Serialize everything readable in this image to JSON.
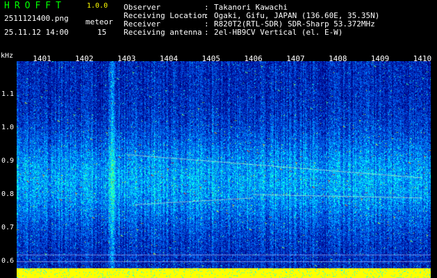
{
  "header": {
    "app_title": "HROFFT",
    "app_version": "1.0.0",
    "file_name": "2511121400.png",
    "time_stamp": "25.11.12 14:00",
    "meteor_label": "meteor",
    "meteor_count": "15"
  },
  "info": [
    {
      "label": "Observer",
      "value": "Takanori Kawachi"
    },
    {
      "label": "Receiving Location",
      "value": "Ogaki, Gifu, JAPAN (136.60E, 35.35N)"
    },
    {
      "label": "Receiver",
      "value": "R820T2(RTL-SDR) SDR-Sharp 53.372MHz"
    },
    {
      "label": "Receiving antenna",
      "value": "2el-HB9CV Vertical (el. E-W)"
    }
  ],
  "info_separator": ":",
  "chart_data": {
    "type": "heatmap",
    "ylabel": "kHz",
    "x_ticks": [
      "1401",
      "1402",
      "1403",
      "1404",
      "1405",
      "1406",
      "1407",
      "1408",
      "1409",
      "1410"
    ],
    "y_ticks": [
      "1.1",
      "1.0",
      "0.9",
      "0.8",
      "0.7",
      "0.6"
    ],
    "y_tick_values": [
      1.1,
      1.0,
      0.9,
      0.8,
      0.7,
      0.6
    ],
    "ylim": [
      0.55,
      1.2
    ],
    "xlim": [
      1400.4,
      1410.2
    ],
    "colormap": [
      "#00007a",
      "#0033cc",
      "#0080ff",
      "#00ffff",
      "#40ff80",
      "#ffff00",
      "#ff0000"
    ],
    "baseline_color": "#ffff00",
    "reference_lines": [
      0.6,
      0.62
    ],
    "meteor_count": 15
  }
}
